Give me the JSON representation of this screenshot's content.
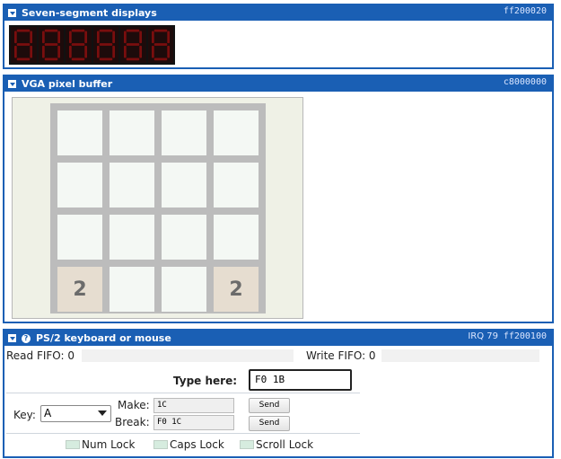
{
  "seven_segment": {
    "title": "Seven-segment displays",
    "address": "ff200020",
    "digits": 6
  },
  "vga": {
    "title": "VGA pixel buffer",
    "address": "c8000000",
    "grid": [
      [
        "",
        "",
        "",
        ""
      ],
      [
        "",
        "",
        "",
        ""
      ],
      [
        "",
        "",
        "",
        ""
      ],
      [
        "2",
        "",
        "",
        "2"
      ]
    ]
  },
  "ps2": {
    "title": "PS/2 keyboard or mouse",
    "irq": "IRQ 79",
    "address": "ff200100",
    "read_fifo": "Read FIFO: 0",
    "write_fifo": "Write FIFO: 0",
    "type_label": "Type here:",
    "type_value": "F0 1B",
    "key_label": "Key:",
    "key_value": "A",
    "make_label": "Make:",
    "make_value": "1C",
    "break_label": "Break:",
    "break_value": "F0 1C",
    "send_label": "Send",
    "leds": [
      "Num Lock",
      "Caps Lock",
      "Scroll Lock"
    ]
  },
  "colors": {
    "accent": "#1a5fb4",
    "segment_off": "#7a0e0e",
    "tile_empty": "#f4f8f4",
    "tile_2": "#e6ddd0",
    "board_bg": "#bcbcbc"
  }
}
